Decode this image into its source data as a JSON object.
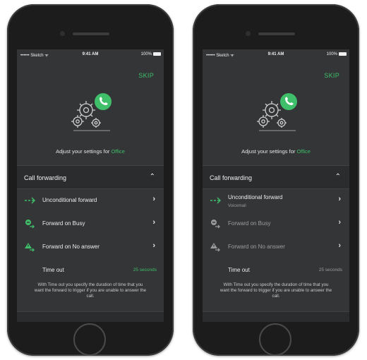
{
  "colors": {
    "accent": "#3fbf6a",
    "screen_bg": "#333536"
  },
  "phones": [
    {
      "status": {
        "carrier": "•••••• Sketch ᯤ",
        "time": "9:41 AM",
        "battery": "100%"
      },
      "skip": "SKIP",
      "adjust_prefix": "Adjust your settings for ",
      "adjust_target": "Office",
      "section_title": "Call forwarding",
      "rows": [
        {
          "label": "Unconditional forward",
          "sub": "",
          "icon": "forward-arrow-icon"
        },
        {
          "label": "Forward on Busy",
          "sub": "",
          "icon": "busy-icon"
        },
        {
          "label": "Forward on No answer",
          "sub": "",
          "icon": "no-answer-icon"
        }
      ],
      "timeout_label": "Time out",
      "timeout_value": "25 seconds",
      "description": "With Time out you specify the duration of time that you want the forward to trigger if you are unable to answer the call."
    },
    {
      "status": {
        "carrier": "•••••• Sketch ᯤ",
        "time": "9:41 AM",
        "battery": "100%"
      },
      "skip": "SKIP",
      "adjust_prefix": "Adjust your settings for ",
      "adjust_target": "Office",
      "section_title": "Call forwarding",
      "rows": [
        {
          "label": "Unconditional forward",
          "sub": "Voicemail",
          "icon": "forward-arrow-icon"
        },
        {
          "label": "Forward on Busy",
          "sub": "",
          "icon": "busy-icon"
        },
        {
          "label": "Forward on No answer",
          "sub": "",
          "icon": "no-answer-icon"
        }
      ],
      "timeout_label": "Time out",
      "timeout_value": "25 seconds",
      "description": "With Time out you specify the duration of time that you want the forward to trigger if you are unable to answer the call."
    }
  ]
}
